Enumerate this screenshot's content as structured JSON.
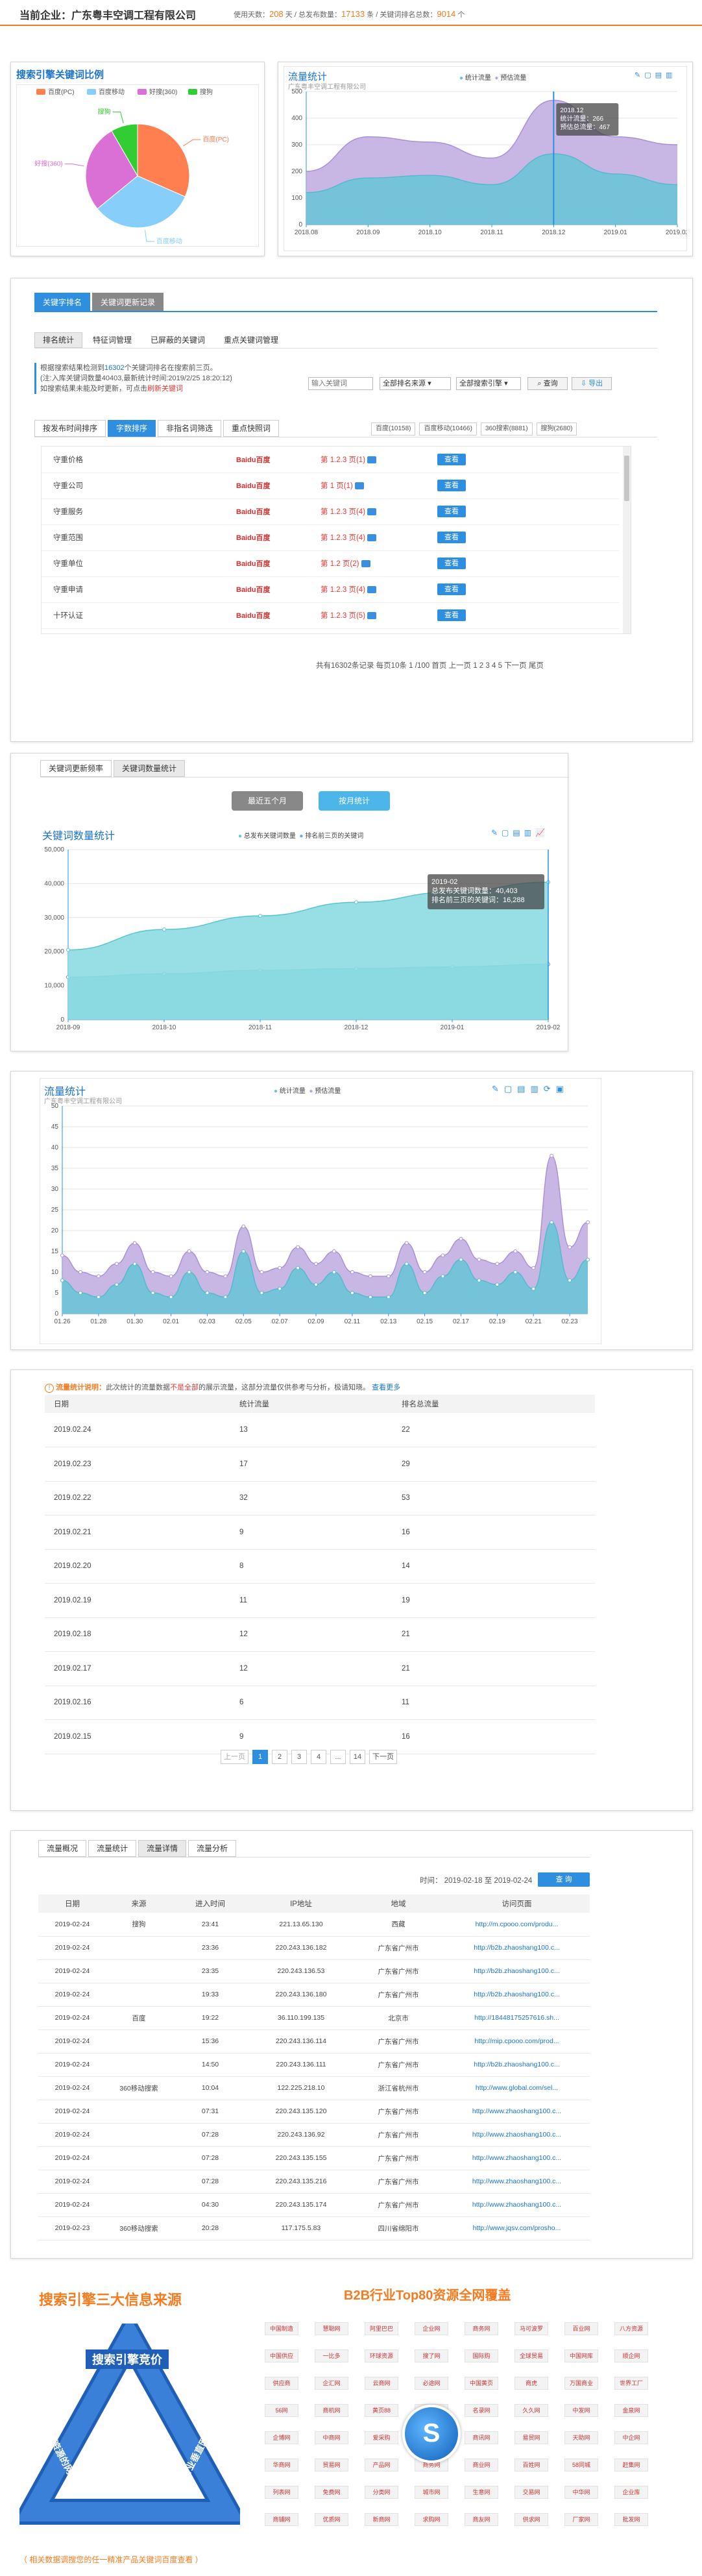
{
  "header": {
    "company_label": "当前企业：广东粤丰空调工程有限公司",
    "stat1_label": "使用天数：",
    "stat1_value": "208",
    "stat1_unit": "天",
    "stat2_label": "/ 总发布数量：",
    "stat2_value": "17133",
    "stat2_unit": "条",
    "stat3_label": "/ 关键词排名总数：",
    "stat3_value": "9014",
    "stat3_unit": "个"
  },
  "pie": {
    "title": "搜索引擎关键词比例",
    "legend": [
      "百度(PC)",
      "百度移动",
      "好搜(360)",
      "搜狗"
    ],
    "labels": [
      "百度(PC)",
      "百度移动",
      "好搜(360)",
      "搜狗"
    ],
    "colors": [
      "#ff7f50",
      "#87cefa",
      "#da70d6",
      "#32cd32"
    ]
  },
  "flow_top": {
    "title": "流量统计",
    "subtitle": "广东粤丰空调工程有限公司",
    "legend": [
      "统计流量",
      "预估流量"
    ],
    "x_labels": [
      "2018.08",
      "2018.09",
      "2018.10",
      "2018.11",
      "2018.12",
      "2019.01",
      "2019.02"
    ],
    "y_labels": [
      "0",
      "100",
      "200",
      "300",
      "400",
      "500"
    ],
    "tooltip": [
      "2018.12",
      "统计流量：266",
      "预估总流量：467"
    ]
  },
  "chart_data": [
    {
      "type": "pie",
      "title": "搜索引擎关键词比例",
      "categories": [
        "百度(PC)",
        "百度移动",
        "好搜(360)",
        "搜狗"
      ],
      "values": [
        10158,
        10466,
        8881,
        2680
      ]
    },
    {
      "type": "area",
      "title": "流量统计",
      "x": [
        "2018.08",
        "2018.09",
        "2018.10",
        "2018.11",
        "2018.12",
        "2019.01",
        "2019.02"
      ],
      "ylim": [
        0,
        500
      ],
      "series": [
        {
          "name": "统计流量",
          "values": [
            120,
            175,
            185,
            150,
            266,
            190,
            150
          ]
        },
        {
          "name": "预估流量",
          "values": [
            200,
            330,
            310,
            250,
            467,
            330,
            300
          ]
        }
      ]
    },
    {
      "type": "area",
      "title": "关键词数量统计",
      "x": [
        "2018-09",
        "2018-10",
        "2018-11",
        "2018-12",
        "2019-01",
        "2019-02"
      ],
      "ylim": [
        0,
        50000
      ],
      "series": [
        {
          "name": "总发布关键词数量",
          "values": [
            20500,
            26500,
            30500,
            34500,
            37500,
            40403
          ]
        },
        {
          "name": "排名前三页的关键词",
          "values": [
            12500,
            13500,
            14500,
            15000,
            15500,
            16288
          ]
        }
      ]
    },
    {
      "type": "area",
      "title": "流量统计",
      "x": [
        "01.26",
        "01.27",
        "01.28",
        "01.29",
        "01.30",
        "01.31",
        "02.01",
        "02.02",
        "02.03",
        "02.04",
        "02.05",
        "02.06",
        "02.07",
        "02.08",
        "02.09",
        "02.10",
        "02.11",
        "02.12",
        "02.13",
        "02.14",
        "02.15",
        "02.16",
        "02.17",
        "02.18",
        "02.19",
        "02.20",
        "02.21",
        "02.22",
        "02.23",
        "02.24"
      ],
      "ylim": [
        0,
        50
      ],
      "series": [
        {
          "name": "统计流量",
          "values": [
            8,
            5,
            4,
            7,
            12,
            5,
            4,
            10,
            5,
            4,
            15,
            5,
            6,
            11,
            7,
            10,
            5,
            4,
            4,
            12,
            5,
            9,
            13,
            8,
            7,
            10,
            6,
            22,
            8,
            13
          ]
        },
        {
          "name": "预估流量",
          "values": [
            14,
            10,
            9,
            12,
            17,
            10,
            9,
            15,
            10,
            9,
            21,
            10,
            11,
            16,
            12,
            15,
            10,
            9,
            9,
            17,
            10,
            14,
            18,
            13,
            12,
            15,
            11,
            38,
            16,
            22
          ]
        }
      ]
    }
  ],
  "kw": {
    "tabs": [
      "关键字排名",
      "关键词更新记录"
    ],
    "subtabs": [
      "排名统计",
      "特征词管理",
      "已屏蔽的关键词",
      "重点关键词管理"
    ],
    "info1a": "根据搜索结果检测到",
    "info1b": "16302",
    "info1c": "个关键词排名在搜索前三页。",
    "info2": "(注:入库关键词数量40403,最新统计时间:2019/2/25 18:20:12)",
    "info3a": "如搜索结果未能及时更新，可点击",
    "info3b": "刷新关键词",
    "search_placeholder": "输入关键词",
    "select1": "全部排名来源",
    "select2": "全部搜索引擎",
    "search_btn": "查询",
    "export_btn": "导出",
    "sort_tabs": [
      "按发布时间排序",
      "字数排序",
      "非指名词筛选",
      "重点快照词"
    ],
    "engine_counts": [
      "百度(10158)",
      "百度移动(10466)",
      "360搜索(8881)",
      "搜狗(2680)"
    ],
    "rows": [
      {
        "kw": "守重价格",
        "engine": "Baidu百度",
        "rank": "第 1.2.3 页(1)",
        "btn": "查看"
      },
      {
        "kw": "守重公司",
        "engine": "Baidu百度",
        "rank": "第 1 页(1)",
        "btn": "查看"
      },
      {
        "kw": "守重服务",
        "engine": "Baidu百度",
        "rank": "第 1.2.3 页(4)",
        "btn": "查看"
      },
      {
        "kw": "守重范围",
        "engine": "Baidu百度",
        "rank": "第 1.2.3 页(4)",
        "btn": "查看"
      },
      {
        "kw": "守重单位",
        "engine": "Baidu百度",
        "rank": "第 1.2 页(2)",
        "btn": "查看"
      },
      {
        "kw": "守重申请",
        "engine": "Baidu百度",
        "rank": "第 1.2.3 页(4)",
        "btn": "查看"
      },
      {
        "kw": "十环认证",
        "engine": "Baidu百度",
        "rank": "第 1.2.3 页(5)",
        "btn": "查看"
      }
    ],
    "pager": "共有16302条记录 每页10条 1 /100  首页 上一页 1 2 3 4 5 下一页 尾页"
  },
  "kwcount": {
    "tabs": [
      "关键词更新频率",
      "关键词数量统计"
    ],
    "btn_left": "最近五个月",
    "btn_right": "按月统计",
    "title": "关键词数量统计",
    "legend": [
      "总发布关键词数量",
      "排名前三页的关键词"
    ],
    "x_labels": [
      "2018-09",
      "2018-10",
      "2018-11",
      "2018-12",
      "2019-01",
      "2019-02"
    ],
    "y_labels": [
      "0",
      "10,000",
      "20,000",
      "30,000",
      "40,000",
      "50,000"
    ],
    "tooltip": [
      "2019-02",
      "总发布关键词数量：40,403",
      "排名前三页的关键词：16,288"
    ]
  },
  "flow2": {
    "title": "流量统计",
    "subtitle": "广东粤丰空调工程有限公司",
    "legend": [
      "统计流量",
      "预估流量"
    ],
    "x_labels": [
      "01.26",
      "01.28",
      "01.30",
      "02.01",
      "02.03",
      "02.05",
      "02.07",
      "02.09",
      "02.11",
      "02.13",
      "02.15",
      "02.17",
      "02.19",
      "02.21",
      "02.23"
    ],
    "y_labels": [
      "0",
      "5",
      "10",
      "15",
      "20",
      "25",
      "30",
      "35",
      "40",
      "45",
      "50"
    ]
  },
  "daily": {
    "note_a": "流量统计说明：",
    "note_b": "此次统计的流量数据",
    "note_c": "不是全部",
    "note_d": "的展示流量，这部分流量仅供参考与分析，极请知晓。",
    "note_e": "查看更多",
    "headers": [
      "日期",
      "统计流量",
      "排名总流量"
    ],
    "rows": [
      [
        "2019.02.24",
        "13",
        "22"
      ],
      [
        "2019.02.23",
        "17",
        "29"
      ],
      [
        "2019.02.22",
        "32",
        "53"
      ],
      [
        "2019.02.21",
        "9",
        "16"
      ],
      [
        "2019.02.20",
        "8",
        "14"
      ],
      [
        "2019.02.19",
        "11",
        "19"
      ],
      [
        "2019.02.18",
        "12",
        "21"
      ],
      [
        "2019.02.17",
        "12",
        "21"
      ],
      [
        "2019.02.16",
        "6",
        "11"
      ],
      [
        "2019.02.15",
        "9",
        "16"
      ]
    ],
    "pager": [
      "上一页",
      "1",
      "2",
      "3",
      "4",
      "...",
      "14",
      "下一页"
    ]
  },
  "detail": {
    "tabs": [
      "流量概况",
      "流量统计",
      "流量详情",
      "流量分析"
    ],
    "time_label": "时间：",
    "date_from": "2019-02-18",
    "to": "至",
    "date_to": "2019-02-24",
    "query": "查 询",
    "headers": [
      "日期",
      "来源",
      "进入时间",
      "IP地址",
      "地域",
      "访问页面"
    ],
    "rows": [
      [
        "2019-02-24",
        "搜狗",
        "23:41",
        "221.13.65.130",
        "西藏",
        "http://m.cpooo.com/produ..."
      ],
      [
        "2019-02-24",
        "",
        "23:36",
        "220.243.136.182",
        "广东省广州市",
        "http://b2b.zhaoshang100.c..."
      ],
      [
        "2019-02-24",
        "",
        "23:35",
        "220.243.136.53",
        "广东省广州市",
        "http://b2b.zhaoshang100.c..."
      ],
      [
        "2019-02-24",
        "",
        "19:33",
        "220.243.136.180",
        "广东省广州市",
        "http://b2b.zhaoshang100.c..."
      ],
      [
        "2019-02-24",
        "百度",
        "19:22",
        "36.110.199.135",
        "北京市",
        "http://18448175257616.sh..."
      ],
      [
        "2019-02-24",
        "",
        "15:36",
        "220.243.136.114",
        "广东省广州市",
        "http://mip.cpooo.com/prod..."
      ],
      [
        "2019-02-24",
        "",
        "14:50",
        "220.243.136.111",
        "广东省广州市",
        "http://b2b.zhaoshang100.c..."
      ],
      [
        "2019-02-24",
        "360移动搜索",
        "10:04",
        "122.225.218.10",
        "浙江省杭州市",
        "http://www.global.com/sel..."
      ],
      [
        "2019-02-24",
        "",
        "07:31",
        "220.243.135.120",
        "广东省广州市",
        "http://www.zhaoshang100.c..."
      ],
      [
        "2019-02-24",
        "",
        "07:28",
        "220.243.136.92",
        "广东省广州市",
        "http://www.zhaoshang100.c..."
      ],
      [
        "2019-02-24",
        "",
        "07:28",
        "220.243.135.155",
        "广东省广州市",
        "http://www.zhaoshang100.c..."
      ],
      [
        "2019-02-24",
        "",
        "07:28",
        "220.243.135.216",
        "广东省广州市",
        "http://www.zhaoshang100.c..."
      ],
      [
        "2019-02-24",
        "",
        "04:30",
        "220.243.135.174",
        "广东省广州市",
        "http://www.zhaoshang100.c..."
      ],
      [
        "2019-02-23",
        "360移动搜索",
        "20:28",
        "117.175.5.83",
        "四川省绵阳市",
        "http://www.jqsv.com/prosho..."
      ]
    ]
  },
  "promo": {
    "left_title": "搜索引擎三大信息来源",
    "tri_top": "搜索引擎竞价",
    "tri_left": "B2B资源的网站",
    "tri_right": "行业垂直网站",
    "left_foot": "（ 相关数据调搜您的任一精准产品关键词百度查看 ）",
    "right_title": "B2B行业Top80资源全网覆盖",
    "logos": [
      "中国制造",
      "慧聪网",
      "阿里巴巴",
      "企业网",
      "商务网",
      "马可波罗",
      "百业网",
      "八方资源",
      "中国供应",
      "一比多",
      "环球资源",
      "搜了网",
      "国际购",
      "全球贸易",
      "中国网库",
      "顺企网",
      "供应商",
      "企汇网",
      "云商网",
      "必途网",
      "中国黄页",
      "商虎",
      "万国商业",
      "世界工厂",
      "56网",
      "商机网",
      "黄页88",
      "采购网",
      "名录网",
      "久久网",
      "中发网",
      "金泉网",
      "企博网",
      "中商网",
      "爱采购",
      "百卓网",
      "商讯网",
      "易贸网",
      "天助网",
      "中企网",
      "华商网",
      "贸易网",
      "产品网",
      "商务网",
      "商业网",
      "百姓网",
      "58同城",
      "赶集网",
      "列表网",
      "免费网",
      "分类网",
      "城市网",
      "生意网",
      "交易网",
      "中华网",
      "企业库",
      "商铺网",
      "优质网",
      "新商网",
      "求购网",
      "商友网",
      "供求网",
      "厂家网",
      "批发网"
    ]
  }
}
